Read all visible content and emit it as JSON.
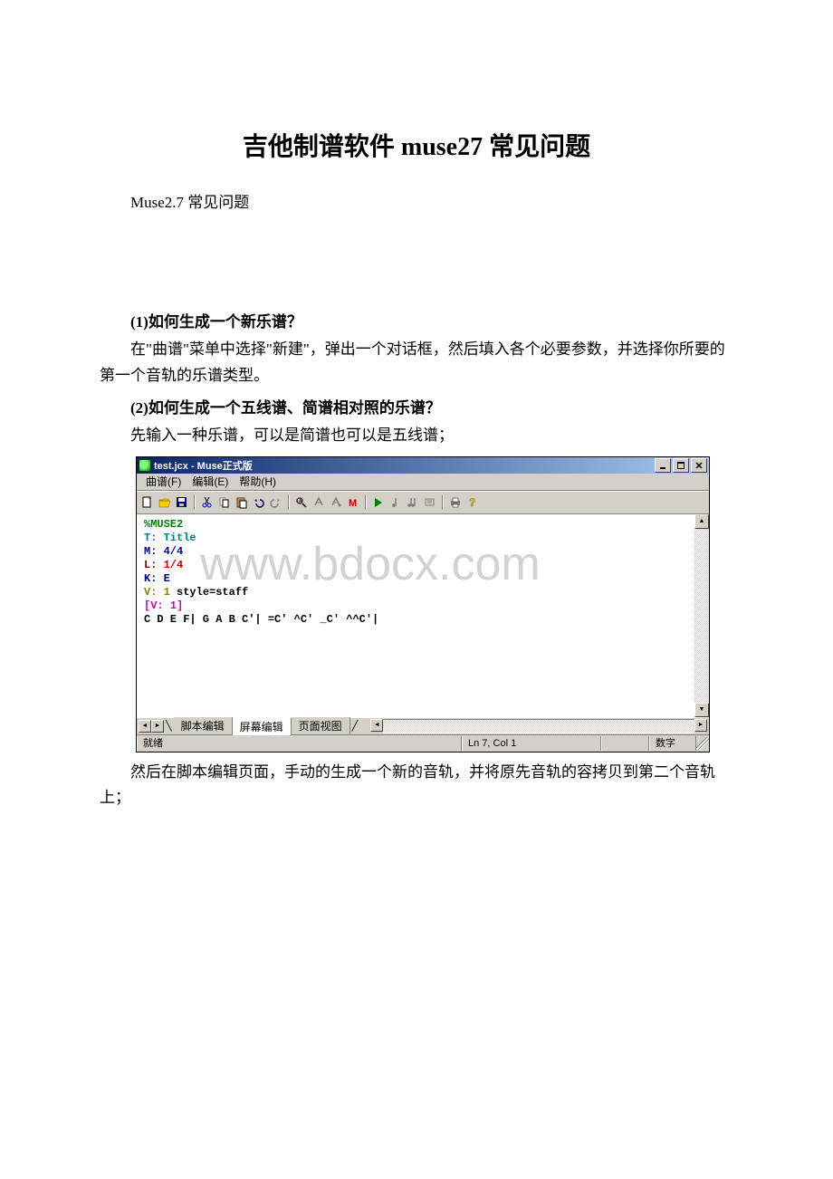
{
  "doc": {
    "title": "吉他制谱软件 muse27 常见问题",
    "intro": "Muse2.7 常见问题",
    "q1_heading": "(1)如何生成一个新乐谱？",
    "q1_body": "在\"曲谱\"菜单中选择\"新建\"，弹出一个对话框，然后填入各个必要参数，并选择你所要的第一个音轨的乐谱类型。",
    "q2_heading": "(2)如何生成一个五线谱、简谱相对照的乐谱？",
    "q2_body1": "先输入一种乐谱，可以是简谱也可以是五线谱；",
    "q2_body2": "然后在脚本编辑页面，手动的生成一个新的音轨，并将原先音轨的容拷贝到第二个音轨上；"
  },
  "app": {
    "title": "test.jcx - Muse正式版",
    "menus": [
      "曲谱(F)",
      "编辑(E)",
      "帮助(H)"
    ],
    "watermark": "www.bdocx.com",
    "code": {
      "l1": "%MUSE2",
      "l2_k": "T:",
      "l2_v": " Title",
      "l3_k": "M:",
      "l3_v": " 4/4",
      "l4_k": "L:",
      "l4_v": " 1/4",
      "l5_k": "K:",
      "l5_v": " E",
      "l6_k": "V:",
      "l6_v1": " 1 ",
      "l6_v2": "style",
      "l6_v3": "=staff",
      "l7": "[V: 1]",
      "l8": "C D E F| G A B C'| =C' ^C' _C' ^^C'|"
    },
    "tabs": {
      "t1": "脚本编辑",
      "t2": "屏幕编辑",
      "t3": "页面视图"
    },
    "status": {
      "ready": "就绪",
      "pos": "Ln 7, Col 1",
      "num": "数字"
    }
  }
}
